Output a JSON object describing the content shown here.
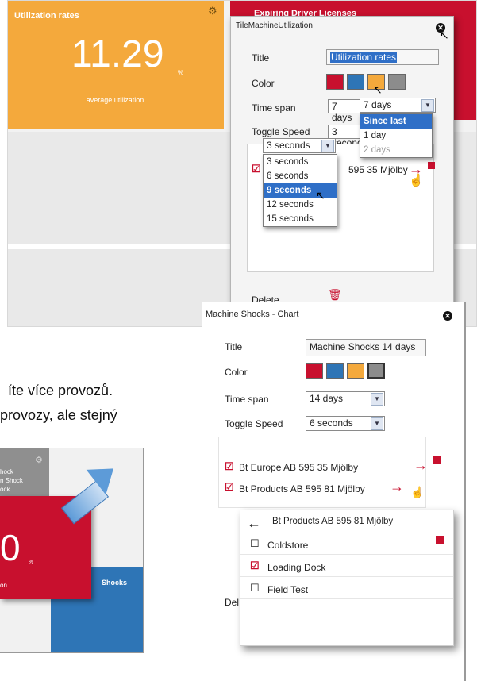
{
  "top": {
    "orange_tile": {
      "title": "Utilization rates",
      "value": "11.29",
      "unit": "%",
      "caption": "average utilization"
    },
    "red_tile": {
      "title": "Expiring Driver Licenses"
    }
  },
  "dialog_top": {
    "title": "TileMachineUtilization",
    "title_label": "Title",
    "title_value": "Utilization rates",
    "color_label": "Color",
    "colors": [
      "#c8102e",
      "#2e75b6",
      "#f4a93c",
      "#8c8c8c"
    ],
    "timespan_label": "Time span",
    "timespan_value": "7 days",
    "timespan_dropdown_value": "7 days",
    "timespan_options": [
      "Since last login",
      "1 day",
      "2 days"
    ],
    "toggle_label": "Toggle Speed",
    "toggle_value": "3 seconds",
    "toggle_dropdown_value": "3 seconds",
    "toggle_options": [
      "3 seconds",
      "6 seconds",
      "9 seconds",
      "12 seconds",
      "15 seconds"
    ],
    "row_text": "595 35 Mjölby",
    "delete_label": "Delete"
  },
  "dialog_chart": {
    "title": "Machine Shocks - Chart",
    "title_label": "Title",
    "title_value": "Machine Shocks 14 days",
    "color_label": "Color",
    "colors": [
      "#c8102e",
      "#2e75b6",
      "#f4a93c",
      "#8c8c8c"
    ],
    "timespan_label": "Time span",
    "timespan_value": "14 days",
    "toggle_label": "Toggle Speed",
    "toggle_value": "6 seconds",
    "items": [
      "Bt Europe AB 595 35 Mjölby",
      "Bt Products AB 595 81 Mjölby"
    ],
    "delete_label": "Del"
  },
  "sub_panel": {
    "header": "Bt Products AB 595 81 Mjölby",
    "items": [
      {
        "label": "Coldstore",
        "checked": false
      },
      {
        "label": "Loading Dock",
        "checked": true
      },
      {
        "label": "Field Test",
        "checked": false
      }
    ]
  },
  "text_fragments": {
    "line1": "íte více provozů.",
    "line2": "provozy, ale stejný"
  },
  "bottom_shot": {
    "small_list": [
      "hock",
      "n Shock",
      "ock"
    ],
    "big_value": "0",
    "unit": "%",
    "caption": "on",
    "blue_label": "Shocks"
  }
}
